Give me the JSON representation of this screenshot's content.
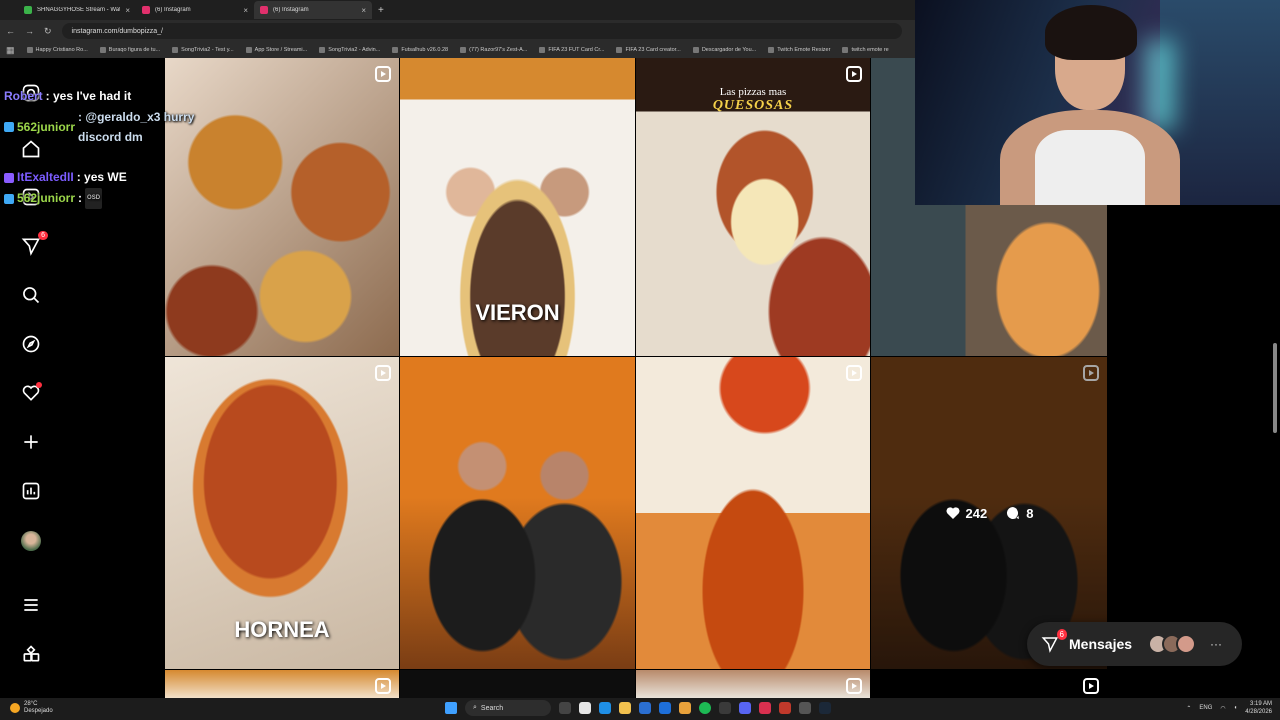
{
  "browser": {
    "tabs": [
      {
        "label": "SHNAGGYHOSE Stream - Wat",
        "active": false,
        "color": "#3bb34a"
      },
      {
        "label": "(6) Instagram",
        "active": false,
        "color": "#e1306c"
      },
      {
        "label": "(6) Instagram",
        "active": true,
        "color": "#e1306c"
      }
    ],
    "url": "instagram.com/dumbopizza_/",
    "bookmarks": [
      "Happy Cristiano Ro...",
      "Buraqo figura de tu...",
      "SongTrivia2 - Test y...",
      "App Store / Streami...",
      "SongTrivia2 - Advin...",
      "Futsalhub v26.0.28",
      "(77) Razor97's Zest-A...",
      "FIFA 23 FUT Card Cr...",
      "FIFA 23 Card creator...",
      "Descargador de You...",
      "Twitch Emote Resizer",
      "twitch emote re"
    ]
  },
  "chat": [
    {
      "user": "Robert",
      "text": ": yes I've had it",
      "icon": false
    },
    {
      "user": "562juniorr",
      "text": ": @geraldo_x3 hurry discord dm",
      "icon": true
    },
    {
      "user": "ItExaltedII",
      "text": ": yes WE",
      "icon": true
    },
    {
      "user": "562juniorr",
      "text": ":",
      "emote": "OSD",
      "icon": true
    }
  ],
  "sidebar": {
    "notifications_badge": "6"
  },
  "posts": [
    {
      "caption": ""
    },
    {
      "caption": "VIERON"
    },
    {
      "subcap": "Las pizzas mas",
      "subcap2": "QUESOSAS"
    },
    {
      "caption": ""
    },
    {
      "caption": "HORNEA"
    },
    {
      "caption": ""
    },
    {
      "caption": ""
    },
    {
      "likes": "242",
      "comments": "8"
    }
  ],
  "messages": {
    "label": "Mensajes",
    "badge": "6"
  },
  "taskbar": {
    "temp": "28°C",
    "weather": "Despejado",
    "search": "Search",
    "lang": "ENG",
    "time": "3:19 AM",
    "date": "4/28/2026"
  }
}
